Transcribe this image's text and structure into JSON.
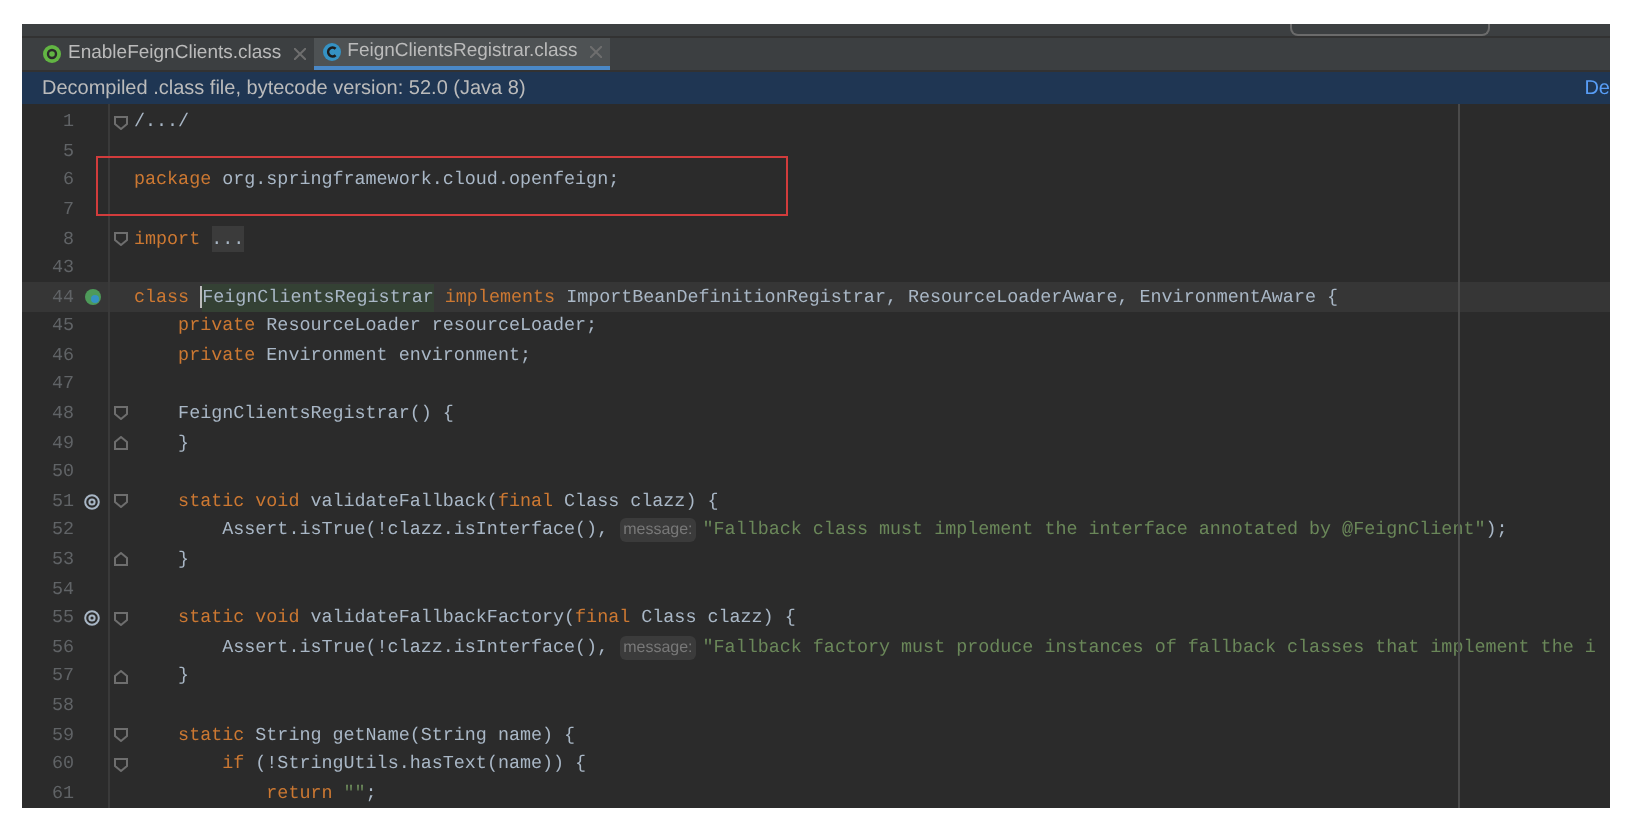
{
  "tabs": [
    {
      "label": "EnableFeignClients.class",
      "selected": false
    },
    {
      "label": "FeignClientsRegistrar.class",
      "selected": true
    }
  ],
  "info_bar": {
    "message": "Decompiled .class file, bytecode version: 52.0 (Java 8)",
    "link": "De"
  },
  "lines": [
    {
      "number": "1",
      "kind": "plain",
      "fold_start": true,
      "fold_end": false,
      "current": false,
      "segments": [
        {
          "kind": "plain",
          "text": "/.../"
        }
      ]
    },
    {
      "number": "5",
      "kind": "plain",
      "fold_start": false,
      "fold_end": false,
      "current": false
    },
    {
      "number": "6",
      "kind": "plain",
      "fold_start": false,
      "fold_end": false,
      "current": false,
      "segments": [
        {
          "kind": "keyword",
          "text": "package "
        },
        {
          "kind": "plain",
          "text": "org.springframework.cloud.openfeign;"
        }
      ]
    },
    {
      "number": "7",
      "kind": "plain",
      "fold_start": false,
      "fold_end": false,
      "current": false
    },
    {
      "number": "8",
      "kind": "plain",
      "fold_start": true,
      "fold_end": false,
      "current": false,
      "segments": [
        {
          "kind": "keyword",
          "text": "import "
        },
        {
          "kind": "folded",
          "text": "..."
        }
      ]
    },
    {
      "number": "43",
      "kind": "plain",
      "fold_start": false,
      "fold_end": false,
      "current": false
    },
    {
      "number": "44",
      "kind": "bean",
      "fold_start": false,
      "fold_end": false,
      "current": true,
      "segments": [
        {
          "kind": "keyword",
          "text": "class "
        },
        {
          "kind": "usage",
          "text": "FeignClientsRegistrar"
        },
        {
          "kind": "keyword",
          "text": " implements "
        },
        {
          "kind": "plain",
          "text": "ImportBeanDefinitionRegistrar, ResourceLoaderAware, EnvironmentAware {"
        }
      ]
    },
    {
      "number": "45",
      "kind": "plain",
      "fold_start": false,
      "fold_end": false,
      "current": false,
      "segments": [
        {
          "kind": "keyword",
          "text": "    private "
        },
        {
          "kind": "plain",
          "text": "ResourceLoader resourceLoader;"
        }
      ]
    },
    {
      "number": "46",
      "kind": "plain",
      "fold_start": false,
      "fold_end": false,
      "current": false,
      "segments": [
        {
          "kind": "keyword",
          "text": "    private "
        },
        {
          "kind": "plain",
          "text": "Environment environment;"
        }
      ]
    },
    {
      "number": "47",
      "kind": "plain",
      "fold_start": false,
      "fold_end": false,
      "current": false
    },
    {
      "number": "48",
      "kind": "plain",
      "fold_start": true,
      "fold_end": false,
      "current": false,
      "segments": [
        {
          "kind": "plain",
          "text": "    FeignClientsRegistrar() {"
        }
      ]
    },
    {
      "number": "49",
      "kind": "plain",
      "fold_start": false,
      "fold_end": true,
      "current": false,
      "segments": [
        {
          "kind": "plain",
          "text": "    }"
        }
      ]
    },
    {
      "number": "50",
      "kind": "plain",
      "fold_start": false,
      "fold_end": false,
      "current": false
    },
    {
      "number": "51",
      "kind": "annotated",
      "fold_start": true,
      "fold_end": false,
      "current": false,
      "segments": [
        {
          "kind": "keyword",
          "text": "    static void "
        },
        {
          "kind": "plain",
          "text": "validateFallback("
        },
        {
          "kind": "keyword",
          "text": "final "
        },
        {
          "kind": "plain",
          "text": "Class clazz) {"
        }
      ]
    },
    {
      "number": "52",
      "kind": "plain",
      "fold_start": false,
      "fold_end": false,
      "current": false,
      "segments": [
        {
          "kind": "plain",
          "text": "        Assert.isTrue(!clazz.isInterface(), "
        },
        {
          "kind": "hint",
          "text": "message:"
        },
        {
          "kind": "string",
          "text": "\"Fallback class must implement the interface annotated by @FeignClient\""
        },
        {
          "kind": "plain",
          "text": ");"
        }
      ]
    },
    {
      "number": "53",
      "kind": "plain",
      "fold_start": false,
      "fold_end": true,
      "current": false,
      "segments": [
        {
          "kind": "plain",
          "text": "    }"
        }
      ]
    },
    {
      "number": "54",
      "kind": "plain",
      "fold_start": false,
      "fold_end": false,
      "current": false
    },
    {
      "number": "55",
      "kind": "annotated",
      "fold_start": true,
      "fold_end": false,
      "current": false,
      "segments": [
        {
          "kind": "keyword",
          "text": "    static void "
        },
        {
          "kind": "plain",
          "text": "validateFallbackFactory("
        },
        {
          "kind": "keyword",
          "text": "final "
        },
        {
          "kind": "plain",
          "text": "Class clazz) {"
        }
      ]
    },
    {
      "number": "56",
      "kind": "plain",
      "fold_start": false,
      "fold_end": false,
      "current": false,
      "segments": [
        {
          "kind": "plain",
          "text": "        Assert.isTrue(!clazz.isInterface(), "
        },
        {
          "kind": "hint",
          "text": "message:"
        },
        {
          "kind": "string",
          "text": "\"Fallback factory must produce instances of fallback classes that implement the i"
        }
      ]
    },
    {
      "number": "57",
      "kind": "plain",
      "fold_start": false,
      "fold_end": true,
      "current": false,
      "segments": [
        {
          "kind": "plain",
          "text": "    }"
        }
      ]
    },
    {
      "number": "58",
      "kind": "plain",
      "fold_start": false,
      "fold_end": false,
      "current": false
    },
    {
      "number": "59",
      "kind": "plain",
      "fold_start": true,
      "fold_end": false,
      "current": false,
      "segments": [
        {
          "kind": "keyword",
          "text": "    static "
        },
        {
          "kind": "plain",
          "text": "String getName(String name) {"
        }
      ]
    },
    {
      "number": "60",
      "kind": "plain",
      "fold_start": true,
      "fold_end": false,
      "current": false,
      "segments": [
        {
          "kind": "keyword",
          "text": "        if "
        },
        {
          "kind": "plain",
          "text": "(!StringUtils.hasText(name)) {"
        }
      ]
    },
    {
      "number": "61",
      "kind": "plain",
      "fold_start": false,
      "fold_end": false,
      "current": false,
      "segments": [
        {
          "kind": "keyword",
          "text": "            return "
        },
        {
          "kind": "string",
          "text": "\"\""
        },
        {
          "kind": "plain",
          "text": ";"
        }
      ]
    }
  ]
}
